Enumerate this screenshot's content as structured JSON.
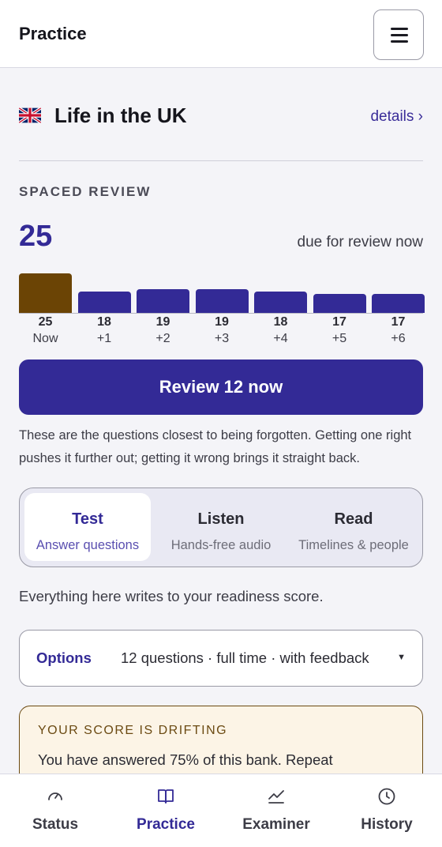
{
  "header": {
    "title": "Practice",
    "menu_icon": "hamburger-menu-icon"
  },
  "bank": {
    "flag_icon": "uk-flag-icon",
    "title": "Life in the UK",
    "details_link": "details ›"
  },
  "spaced_review": {
    "label": "SPACED REVIEW",
    "due_count": "25",
    "due_text": "due for review now",
    "chart_data": {
      "type": "bar",
      "categories": [
        "Now",
        "+1",
        "+2",
        "+3",
        "+4",
        "+5",
        "+6"
      ],
      "values": [
        25,
        18,
        19,
        19,
        18,
        17,
        17
      ],
      "highlight_index": 0,
      "highlight_color": "#6b4405",
      "bar_color": "#332a96"
    },
    "value_labels": [
      "25",
      "18",
      "19",
      "19",
      "18",
      "17",
      "17"
    ],
    "review_button": "Review 12 now",
    "explanation": "These are the questions closest to being forgotten. Getting one right pushes it further out; getting it wrong brings it straight back."
  },
  "modes": [
    {
      "title": "Test",
      "subtitle": "Answer questions",
      "active": true
    },
    {
      "title": "Listen",
      "subtitle": "Hands-free audio",
      "active": false
    },
    {
      "title": "Read",
      "subtitle": "Timelines & people",
      "active": false
    }
  ],
  "readiness_note": "Everything here writes to your readiness score.",
  "options": {
    "label": "Options",
    "value": "12 questions · full time · with feedback",
    "caret": "▼"
  },
  "alert": {
    "title": "YOUR SCORE IS DRIFTING",
    "text": "You have answered 75% of this bank. Repeat"
  },
  "bottom_nav": [
    {
      "label": "Status",
      "icon": "gauge-icon",
      "active": false
    },
    {
      "label": "Practice",
      "icon": "book-icon",
      "active": true
    },
    {
      "label": "Examiner",
      "icon": "trend-chart-icon",
      "active": false
    },
    {
      "label": "History",
      "icon": "clock-icon",
      "active": false
    }
  ],
  "colors": {
    "accent": "#332a96",
    "warning_border": "#6b4a12",
    "warning_bg": "#fcf4e6"
  }
}
